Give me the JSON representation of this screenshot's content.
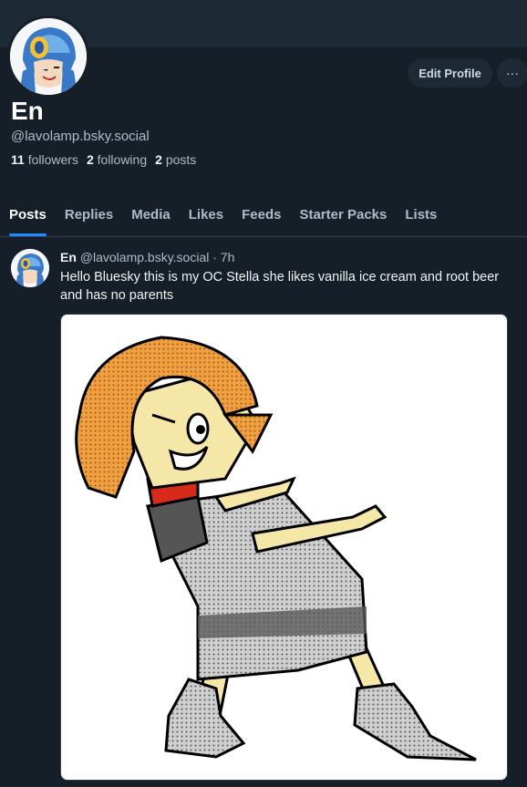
{
  "profile": {
    "display_name": "En",
    "handle": "@lavolamp.bsky.social",
    "followers_count": "11",
    "followers_label": "followers",
    "following_count": "2",
    "following_label": "following",
    "posts_count": "2",
    "posts_label": "posts",
    "edit_button": "Edit Profile",
    "more_button": "···"
  },
  "tabs": [
    {
      "label": "Posts",
      "active": true
    },
    {
      "label": "Replies"
    },
    {
      "label": "Media"
    },
    {
      "label": "Likes"
    },
    {
      "label": "Feeds"
    },
    {
      "label": "Starter Packs"
    },
    {
      "label": "Lists"
    }
  ],
  "post": {
    "author": "En",
    "handle": "@lavolamp.bsky.social",
    "separator": "·",
    "time": "7h",
    "text": "Hello Bluesky this is my OC Stella she likes vanilla ice cream and root beer and has no parents"
  },
  "icons": {
    "more": "ellipsis-icon",
    "avatar": "robot-helmet-avatar"
  },
  "colors": {
    "background": "#161e27",
    "banner": "#1e2936",
    "accent": "#208bfe",
    "muted_text": "#aebbc9"
  }
}
